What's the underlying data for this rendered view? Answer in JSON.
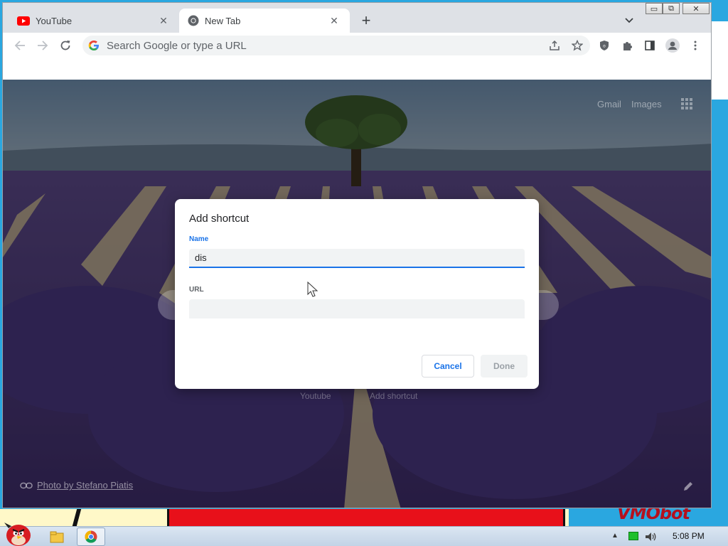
{
  "browser": {
    "tabs": [
      {
        "title": "YouTube",
        "icon": "youtube-icon"
      },
      {
        "title": "New Tab",
        "icon": "chrome-icon"
      }
    ],
    "window_controls": {
      "minimize": "▭",
      "maximize": "⧉",
      "close": "✕"
    },
    "omnibox": {
      "placeholder": "Search Google or type a URL"
    }
  },
  "ntp": {
    "top_links": [
      "Gmail",
      "Images"
    ],
    "shortcuts": [
      "Youtube",
      "Add shortcut"
    ],
    "photo_credit": "Photo by Stefano Piatis"
  },
  "dialog": {
    "title": "Add shortcut",
    "name_label": "Name",
    "name_value": "dis",
    "url_label": "URL",
    "url_value": "",
    "cancel_label": "Cancel",
    "done_label": "Done"
  },
  "taskbar": {
    "clock": "5:08 PM",
    "show_hidden_icons": "▲"
  },
  "desktop": {
    "wallpaper_text": "VMObot"
  },
  "colors": {
    "accent": "#1a73e8",
    "tab_strip": "#dee1e6",
    "youtube_red": "#ff0000"
  }
}
